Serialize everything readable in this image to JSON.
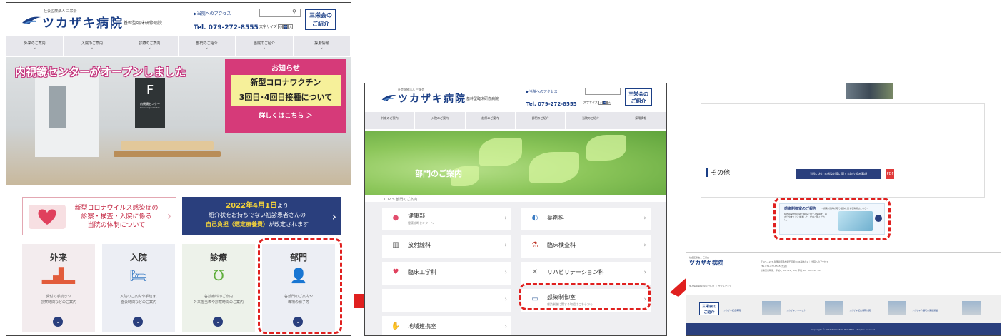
{
  "header": {
    "org": "社会医療法人 三栄会",
    "hospital_name": "ツカザキ病院",
    "sub_title": "基幹型臨床研修病院",
    "access": "▶当院へのアクセス",
    "tel": "Tel. 079-272-8555",
    "font_size_label": "文字サイズ",
    "font_sizes": [
      "小",
      "中",
      "大"
    ],
    "search_icon": "search-icon",
    "sankei_line1": "三栄会の",
    "sankei_line2": "ご紹介"
  },
  "nav": [
    "外来のご案内",
    "入院のご案内",
    "診療のご案内",
    "部門のご紹介",
    "当院のご紹介",
    "採用情報"
  ],
  "home": {
    "hero_title": "内視鏡センターがオープンしました",
    "sign_letter": "F",
    "sign_text": "内視鏡センター",
    "sign_text_en": "Endoscopy Center",
    "notice": {
      "heading": "お知らせ",
      "line1": "新型コロナワクチン",
      "line2": "3回目･4回目接種について",
      "more": "詳しくはこちら ＞"
    },
    "banner1": {
      "line1": "新型コロナウイルス感染症の",
      "line2": "診察・検査・入院に係る",
      "line3": "当院の体制について"
    },
    "banner2": {
      "line1_a": "2022年4月1日",
      "line1_b": "より",
      "line2": "紹介状をお持ちでない初診患者さんの",
      "line3_a": "自己負担（選定療養費）",
      "line3_b": "が改定されます"
    },
    "cards": [
      {
        "title": "外来",
        "icon": "reception-icon",
        "desc1": "受付の手続きや",
        "desc2": "診察時間などのご案内",
        "color": "#f3ecee"
      },
      {
        "title": "入院",
        "icon": "bed-icon",
        "desc1": "入院のご案内や手続き,",
        "desc2": "面会時間などのご案内",
        "color": "#eceef4"
      },
      {
        "title": "診療",
        "icon": "stethoscope-icon",
        "desc1": "各診療科のご案内",
        "desc2": "外来担当表や診察時間のご案内",
        "color": "#edf2ea"
      },
      {
        "title": "部門",
        "icon": "staff-icon",
        "desc1": "各部門のご案内や",
        "desc2": "職場の様子等",
        "color": "#eceef4"
      }
    ]
  },
  "department_page": {
    "hero_title": "部門のご案内",
    "breadcrumb": "TOP > 部門のご案内",
    "items": [
      {
        "label": "健康部",
        "sub": "健康診断センターへ",
        "icon": "health-icon",
        "col": 0,
        "row": 0
      },
      {
        "label": "薬剤科",
        "sub": "",
        "icon": "pharmacy-icon",
        "col": 1,
        "row": 0
      },
      {
        "label": "放射線科",
        "sub": "",
        "icon": "radiology-icon",
        "col": 0,
        "row": 1
      },
      {
        "label": "臨床検査科",
        "sub": "",
        "icon": "microscope-icon",
        "col": 1,
        "row": 1
      },
      {
        "label": "臨床工学科",
        "sub": "",
        "icon": "heartbeat-icon",
        "col": 0,
        "row": 2
      },
      {
        "label": "リハビリテーション科",
        "sub": "",
        "icon": "rehab-icon",
        "col": 1,
        "row": 2
      },
      {
        "label": "",
        "sub": "",
        "icon": "",
        "col": 0,
        "row": 3
      },
      {
        "label": "感染制御室",
        "sub": "感染制御に関する取組はこちらから",
        "icon": "mask-icon",
        "col": 1,
        "row": 3
      },
      {
        "label": "地域連携室",
        "sub": "",
        "icon": "handshake-icon",
        "col": 0,
        "row": 4
      }
    ]
  },
  "infection_page": {
    "section_title": "その他",
    "pdf_button": "当院における感染対策に関する取り組み事項",
    "pdf_icon_label": "PDF",
    "card_title": "感染制御室のご報告",
    "card_sub": "～感染対策等の取り組みに関する情報はこちら～",
    "card_body": "院内感染対策の取り組みに関する情報を、わかりやすくまとめました。ぜひご覧ください。",
    "footer_name": "ツカザキ病院",
    "footer_org": "社会医療法人 三栄会",
    "footer_address": "〒671-1227 兵庫県姫路市網干区和久68番地の1 ｜ 当院へのアクセス",
    "footer_tel": "TEL 079-272-8555 (代表)",
    "footer_hours": "診察受付時間：午前8：00～11：30 / 午後 12：30～16：00",
    "footer_links": "個人情報保護方針について ｜ サイトマップ",
    "sankei_line1": "三栄会の",
    "sankei_line2": "ご紹介",
    "group": [
      "ツカザキ記念病院",
      "ツカザキクリニック",
      "ツカザキ記念病院付属",
      "ツカザキ介護老人保健施設"
    ],
    "copyright": "Copyright © 2022 TSUKAZAKI HOSPITAL All rights reserved."
  },
  "annotations": {
    "highlight_color": "#e0201f",
    "arrow_color": "#e0201f"
  }
}
